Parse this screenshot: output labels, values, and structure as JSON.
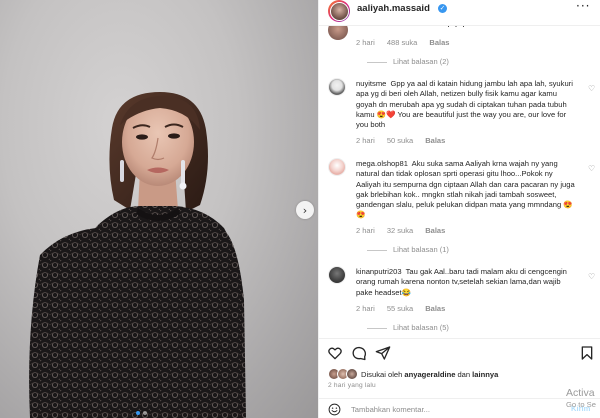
{
  "post": {
    "username": "aaliyah.massaid",
    "verified_symbol": "✓",
    "more_symbol": "···",
    "photo_alt_visible": "",
    "carousel_next_symbol": "›"
  },
  "peek": {
    "text": "· · ·",
    "meta": {
      "time": "2 hari",
      "likes": "488 suka",
      "reply": "Balas"
    },
    "view_replies": "Lihat balasan (2)"
  },
  "comments": [
    {
      "user": "nuyitsme",
      "text": "Gpp ya aal di katain hidung jambu lah apa lah, syukuri apa yg di beri oleh Allah, netizen bully fisik kamu agar kamu goyah dn merubah apa yg sudah di ciptakan tuhan pada tubuh kamu 😍❤️ You are beautiful just the way you are, our love for you both",
      "time": "2 hari",
      "likes": "50 suka",
      "reply": "Balas",
      "view_replies": ""
    },
    {
      "user": "mega.olshop81",
      "text": "Aku suka sama Aaliyah krna wajah ny yang natural dan tidak oplosan sprti operasi gitu lhoo...Pokok ny Aaliyah itu sempurna dgn ciptaan Allah dan cara pacaran ny juga gak brlebihan kok.. mngkn stlah nikah jadi tambah sosweet, gandengan slalu, peluk pelukan didpan mata yang mmndang 😍😍",
      "time": "2 hari",
      "likes": "32 suka",
      "reply": "Balas",
      "view_replies": "Lihat balasan (1)"
    },
    {
      "user": "kinanputri203",
      "text": "Tau gak Aal..baru tadi malam aku di cengcengin orang rumah karena nonton tv,setelah sekian lama,dan wajib pake headset😂",
      "time": "2 hari",
      "likes": "55 suka",
      "reply": "Balas",
      "view_replies": "Lihat balasan (5)"
    }
  ],
  "actions": {
    "liked_prefix": "Disukai oleh",
    "liked_user": "anyageraldine",
    "liked_suffix": "dan",
    "liked_others": "lainnya",
    "time_ago": "2 hari yang lalu",
    "comment_placeholder": "Tambahkan komentar...",
    "post_label": "Kirim"
  },
  "watermark": {
    "line1": "Activa",
    "line2": "Go to Se"
  },
  "colors": {
    "accent_blue": "#3897f0",
    "muted_text": "#8e8e8e",
    "text": "#262626"
  }
}
